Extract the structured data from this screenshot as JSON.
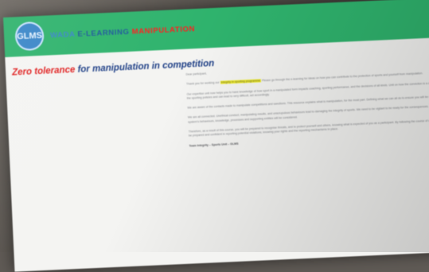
{
  "header": {
    "logo_text": "GLMS",
    "brand_part1": "WADA",
    "brand_part2": "E-LEARNING",
    "brand_part3": "MANIPULATION"
  },
  "page": {
    "heading_red": "Zero tolerance",
    "heading_rest": " for manipulation in competition"
  },
  "email": {
    "greeting": "Dear participant,",
    "p1_before": "Thank you for working our",
    "p1_highlight": "integrity in sporting programme",
    "p1_after": "Please go through the e-learning for ideas on how you can contribute to the protection of sports and yourself from manipulation.",
    "p2": "Our expertise unit now helps you to have knowledge of how sport in a manipulated form impacts coaching, sporting performance, and the decisions of all kinds. Unit on how the conviction is a clear breach of the sporting policies and can lead to very difficult, act accordingly.",
    "p3": "We are aware of the contacts made to manipulate competitions and sanctions. This resource explains what is manipulation, for the most part. Defining what we can all do to ensure you will be credible.",
    "p4": "We are all connected. Unethical conduct, manipulating results, and unscrupulous behaviours lead to damaging the integrity of sports. We need to be vigilant to be ready for the consequences. Our sports system's behaviours, knowledge, processes and supporting entities will be considered.",
    "p5": "Therefore, as a result of this course, you will be prepared to recognise threats, and to protect yourself and others, knowing what is expected of you as a participant. By following the course of action, you will be prepared and confident in reporting potential violations, knowing your rights and the reporting mechanisms in place.",
    "signature": "Team Integrity – Sports Unit – GLMS"
  }
}
